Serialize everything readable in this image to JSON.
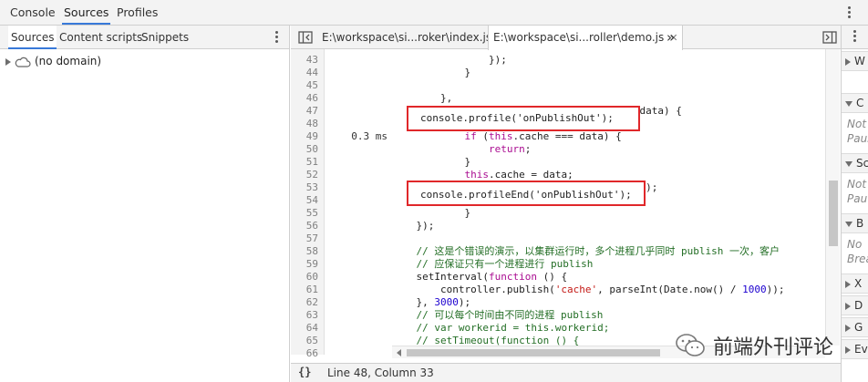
{
  "top_tabs": [
    "Console",
    "Sources",
    "Profiles"
  ],
  "active_top_tab": "Sources",
  "navigator": {
    "tabs": [
      "Sources",
      "Content scripts",
      "Snippets"
    ],
    "tree": [
      {
        "label": "(no domain)"
      }
    ]
  },
  "editor": {
    "tabs": [
      {
        "label": "E:\\workspace\\si...roker\\index.js"
      },
      {
        "label": "E:\\workspace\\si...roller\\demo.js"
      }
    ],
    "more_tabs_glyph": "»",
    "lines": [
      {
        "n": "43",
        "time": "",
        "code": "                });"
      },
      {
        "n": "44",
        "time": "",
        "code": "            }"
      },
      {
        "n": "45",
        "time": "",
        "code": ""
      },
      {
        "n": "46",
        "time": "",
        "code": "        },"
      },
      {
        "n": "47",
        "time": "",
        "code": "        onPublishOut: function (context, data) {"
      },
      {
        "n": "48",
        "time": "",
        "code": ""
      },
      {
        "n": "49",
        "time": "0.3 ms",
        "code": "            if (this.cache === data) {"
      },
      {
        "n": "50",
        "time": "",
        "code": "                return;"
      },
      {
        "n": "51",
        "time": "",
        "code": "            }"
      },
      {
        "n": "52",
        "time": "",
        "code": "            this.cache = data;"
      },
      {
        "n": "53",
        "time": "",
        "code": "            this.last_modified = Date.now();"
      },
      {
        "n": "54",
        "time": "",
        "code": ""
      },
      {
        "n": "55",
        "time": "",
        "code": "            }"
      },
      {
        "n": "56",
        "time": "",
        "code": "    });"
      },
      {
        "n": "57",
        "time": "",
        "code": ""
      },
      {
        "n": "58",
        "time": "",
        "code": "    // 这是个错误的演示，以集群运行时，多个进程几乎同时 publish 一次，客户"
      },
      {
        "n": "59",
        "time": "",
        "code": "    // 应保证只有一个进程进行 publish"
      },
      {
        "n": "60",
        "time": "",
        "code": "    setInterval(function () {"
      },
      {
        "n": "61",
        "time": "",
        "code": "        controller.publish('cache', parseInt(Date.now() / 1000));"
      },
      {
        "n": "62",
        "time": "",
        "code": "    }, 3000);"
      },
      {
        "n": "63",
        "time": "",
        "code": "    // 可以每个时间由不同的进程 publish"
      },
      {
        "n": "64",
        "time": "",
        "code": "    // var workerid = this.workerid;"
      },
      {
        "n": "65",
        "time": "",
        "code": "    // setTimeout(function () {"
      },
      {
        "n": "66",
        "time": "",
        "code": ""
      }
    ],
    "highlight_1": "console.profile('onPublishOut');",
    "highlight_2": "console.profileEnd('onPublishOut');"
  },
  "status": {
    "braces": "{}",
    "position": "Line 48, Column 33"
  },
  "sidebar": {
    "sections": [
      {
        "label": "W",
        "expanded": false
      },
      {
        "label": "C",
        "expanded": true,
        "note": "Not",
        "note2": "Pause"
      },
      {
        "label": "Sc",
        "expanded": true,
        "note": "Not",
        "note2": "Pau"
      },
      {
        "label": "B",
        "expanded": true,
        "note": "No",
        "note2": "Brea"
      },
      {
        "label": "X",
        "expanded": false
      },
      {
        "label": "D",
        "expanded": false
      },
      {
        "label": "G",
        "expanded": false
      },
      {
        "label": "Ev",
        "expanded": false
      }
    ]
  },
  "watermark": "前端外刊评论",
  "colors": {
    "accent": "#3879d9",
    "highlight_border": "#e0272a"
  }
}
